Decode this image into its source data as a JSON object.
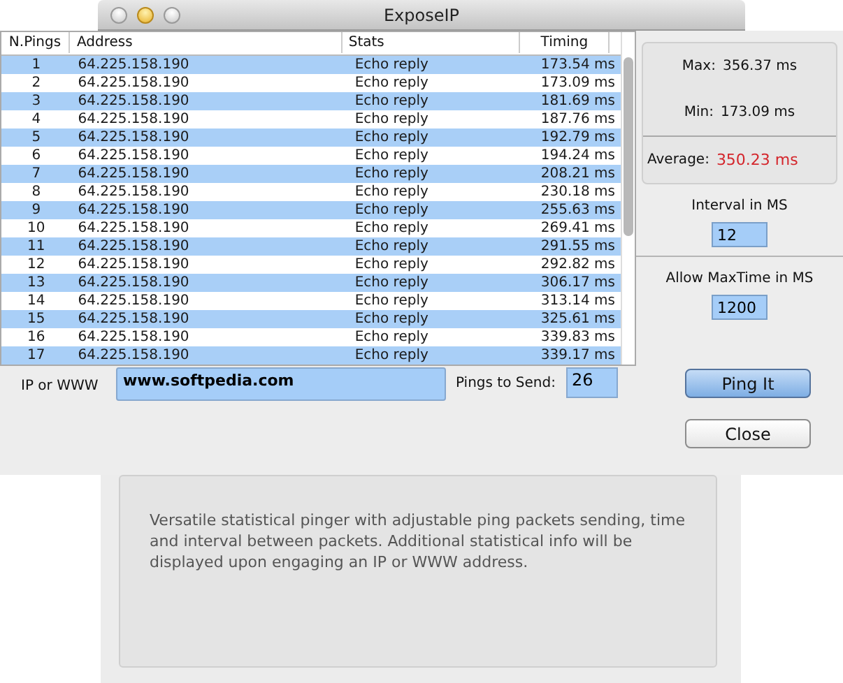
{
  "window": {
    "title": "ExposeIP"
  },
  "table": {
    "columns": [
      "N.Pings",
      "Address",
      "Stats",
      "Timing"
    ],
    "rows": [
      {
        "n": "1",
        "address": "64.225.158.190",
        "stats": "Echo reply",
        "timing": "173.54 ms"
      },
      {
        "n": "2",
        "address": "64.225.158.190",
        "stats": "Echo reply",
        "timing": "173.09 ms"
      },
      {
        "n": "3",
        "address": "64.225.158.190",
        "stats": "Echo reply",
        "timing": "181.69 ms"
      },
      {
        "n": "4",
        "address": "64.225.158.190",
        "stats": "Echo reply",
        "timing": "187.76 ms"
      },
      {
        "n": "5",
        "address": "64.225.158.190",
        "stats": "Echo reply",
        "timing": "192.79 ms"
      },
      {
        "n": "6",
        "address": "64.225.158.190",
        "stats": "Echo reply",
        "timing": "194.24 ms"
      },
      {
        "n": "7",
        "address": "64.225.158.190",
        "stats": "Echo reply",
        "timing": "208.21 ms"
      },
      {
        "n": "8",
        "address": "64.225.158.190",
        "stats": "Echo reply",
        "timing": "230.18 ms"
      },
      {
        "n": "9",
        "address": "64.225.158.190",
        "stats": "Echo reply",
        "timing": "255.63 ms"
      },
      {
        "n": "10",
        "address": "64.225.158.190",
        "stats": "Echo reply",
        "timing": "269.41 ms"
      },
      {
        "n": "11",
        "address": "64.225.158.190",
        "stats": "Echo reply",
        "timing": "291.55 ms"
      },
      {
        "n": "12",
        "address": "64.225.158.190",
        "stats": "Echo reply",
        "timing": "292.82 ms"
      },
      {
        "n": "13",
        "address": "64.225.158.190",
        "stats": "Echo reply",
        "timing": "306.17 ms"
      },
      {
        "n": "14",
        "address": "64.225.158.190",
        "stats": "Echo reply",
        "timing": "313.14 ms"
      },
      {
        "n": "15",
        "address": "64.225.158.190",
        "stats": "Echo reply",
        "timing": "325.61 ms"
      },
      {
        "n": "16",
        "address": "64.225.158.190",
        "stats": "Echo reply",
        "timing": "339.83 ms"
      },
      {
        "n": "17",
        "address": "64.225.158.190",
        "stats": "Echo reply",
        "timing": "339.17 ms"
      }
    ]
  },
  "stats": {
    "max_label": "Max:",
    "max": "356.37 ms",
    "min_label": "Min:",
    "min": "173.09 ms",
    "average_label": "Average:",
    "average": "350.23 ms"
  },
  "interval": {
    "label": "Interval in MS",
    "value": "12"
  },
  "max_time": {
    "label": "Allow MaxTime in MS",
    "value": "1200"
  },
  "target": {
    "label": "IP or WWW",
    "value": "www.softpedia.com"
  },
  "pings": {
    "label": "Pings to Send:",
    "value": "26"
  },
  "buttons": [
    {
      "label": "Ping It",
      "kind": "default"
    },
    {
      "label": "Close",
      "kind": "normal"
    }
  ],
  "info": {
    "text": "Versatile statistical pinger with adjustable ping packets sending, time and interval between packets. Additional statistical info will be displayed upon engaging an IP or WWW address."
  }
}
